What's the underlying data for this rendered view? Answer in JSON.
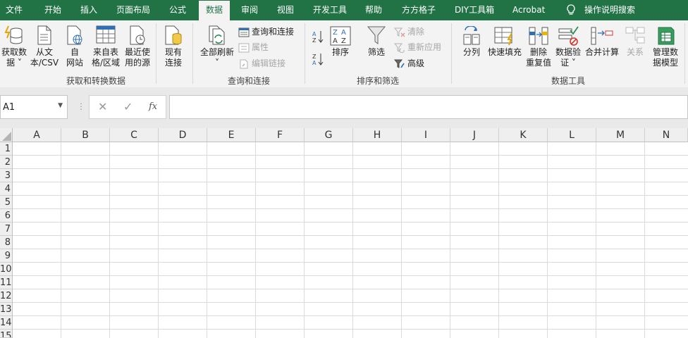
{
  "tabs": [
    "文件",
    "开始",
    "插入",
    "页面布局",
    "公式",
    "数据",
    "审阅",
    "视图",
    "开发工具",
    "帮助",
    "方方格子",
    "DIY工具箱",
    "Acrobat"
  ],
  "active_tab": "数据",
  "tell_me": "操作说明搜索",
  "ribbon": {
    "get_data": "获取数\n据 ˅",
    "from_text": "从文\n本/CSV",
    "from_web": "自\n网站",
    "from_table": "来自表\n格/区域",
    "recent_sources": "最近使\n用的源",
    "existing_conn": "现有\n连接",
    "group_get_transform": "获取和转换数据",
    "refresh_all": "全部刷新\n˅",
    "queries_conn": "查询和连接",
    "properties": "属性",
    "edit_links": "编辑链接",
    "group_queries": "查询和连接",
    "sort": "排序",
    "filter": "筛选",
    "clear": "清除",
    "reapply": "重新应用",
    "advanced": "高级",
    "group_sort_filter": "排序和筛选",
    "text_to_cols": "分列",
    "flash_fill": "快速填充",
    "remove_dup": "删除\n重复值",
    "data_validation": "数据验\n证 ˅",
    "consolidate": "合并计算",
    "relationships": "关系",
    "manage_model": "管理数\n据模型",
    "group_data_tools": "数据工具"
  },
  "namebox": "A1",
  "columns": [
    "A",
    "B",
    "C",
    "D",
    "E",
    "F",
    "G",
    "H",
    "I",
    "J",
    "K",
    "L",
    "M",
    "N"
  ],
  "rows": [
    "1",
    "2",
    "3",
    "4",
    "5",
    "6",
    "7",
    "8",
    "9",
    "10",
    "11",
    "12",
    "13",
    "14",
    "15"
  ],
  "colors": {
    "accent": "#217346",
    "ribbon_bg": "#f3f3f3",
    "grid_line": "#dadada"
  }
}
